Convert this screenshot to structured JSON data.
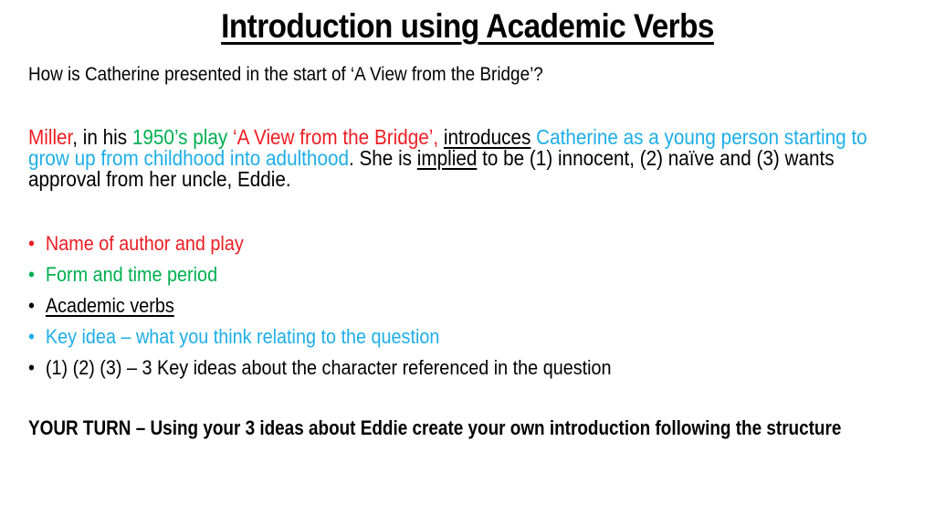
{
  "slide": {
    "title": "Introduction using Academic Verbs",
    "question": "How is Catherine presented in the start of ‘A View from the Bridge’?",
    "paragraph": {
      "author": "Miller",
      "sep1": ", in his ",
      "period": "1950’s play",
      "sep2": " ",
      "play": "‘A View from the Bridge’,",
      "sep3": " ",
      "verb1": "introduces",
      "sep4": " ",
      "key_idea": "Catherine as a young person starting to grow up from childhood into adulthood",
      "sep5": ". She is ",
      "verb2": "implied",
      "rest": " to be (1) innocent, (2) naïve and (3) wants approval from her uncle, Eddie."
    },
    "bullets": [
      {
        "text": "Name of author and play",
        "color": "#EE1D23"
      },
      {
        "text": "Form and time period",
        "color": "#00B050"
      },
      {
        "text": "Academic verbs",
        "color": "#000000"
      },
      {
        "text": "Key idea – what you think relating to the question",
        "color": "#1DAEE8"
      },
      {
        "text": "(1) (2) (3) – 3 Key ideas about the character referenced in the question",
        "color": "#000000"
      }
    ],
    "your_turn": "YOUR TURN – Using your 3 ideas about Eddie create your own introduction following the structure"
  }
}
